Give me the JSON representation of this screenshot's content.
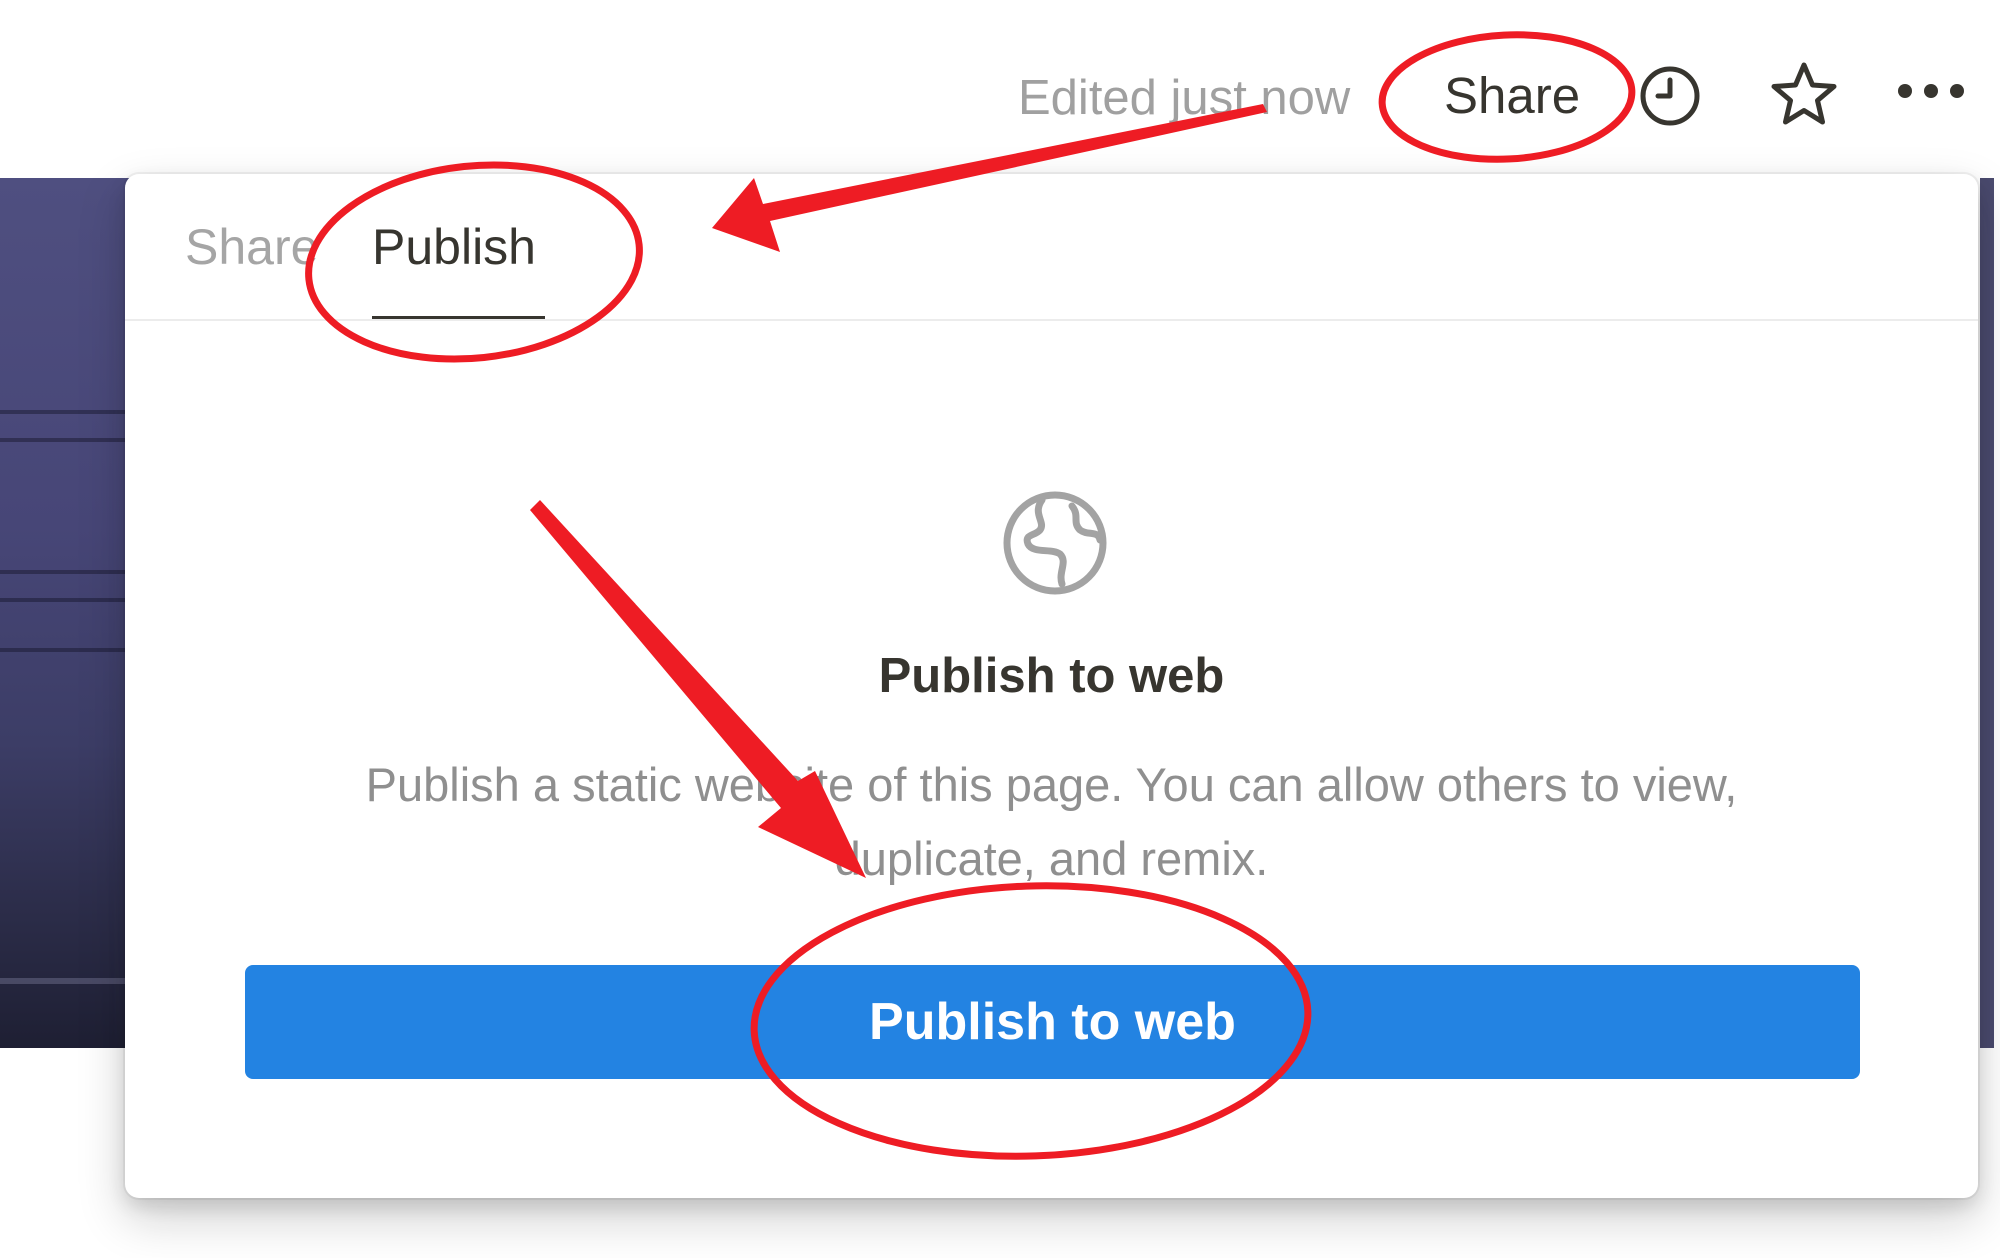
{
  "topbar": {
    "edited_status": "Edited just now",
    "share_label": "Share",
    "icons": [
      "history-clock-icon",
      "favorite-star-icon",
      "more-options-icon"
    ]
  },
  "popover": {
    "tabs": [
      {
        "label": "Share",
        "active": false
      },
      {
        "label": "Publish",
        "active": true
      }
    ],
    "icon": "globe-icon",
    "heading": "Publish to web",
    "description": "Publish a static website of this page. You can allow others to view, duplicate, and remix.",
    "button_label": "Publish to web"
  },
  "colors": {
    "accent": "#2383e2",
    "annotation": "#ee1c24",
    "text_primary": "#37352f",
    "text_muted": "#8f8f8f"
  }
}
